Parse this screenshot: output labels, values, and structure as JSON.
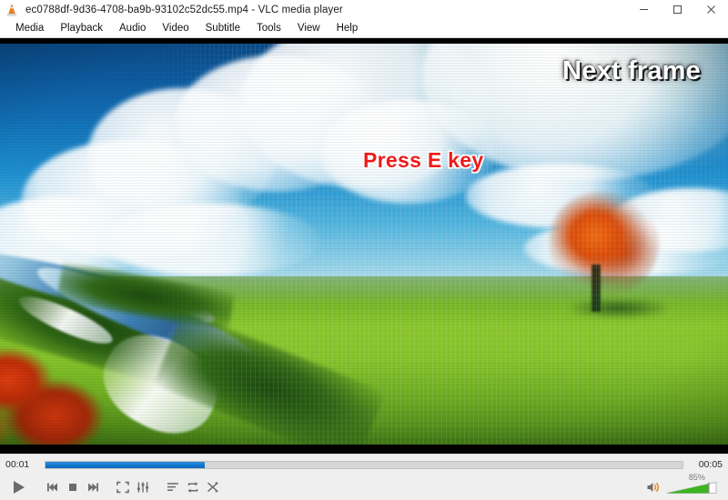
{
  "window": {
    "app_icon": "vlc-cone-icon",
    "title": "ec0788df-9d36-4708-ba9b-93102c52dc55.mp4 - VLC media player",
    "controls": {
      "minimize": "minimize-icon",
      "maximize": "maximize-icon",
      "close": "close-icon"
    }
  },
  "menubar": {
    "items": [
      {
        "label": "Media"
      },
      {
        "label": "Playback"
      },
      {
        "label": "Audio"
      },
      {
        "label": "Video"
      },
      {
        "label": "Subtitle"
      },
      {
        "label": "Tools"
      },
      {
        "label": "View"
      },
      {
        "label": "Help"
      }
    ]
  },
  "video": {
    "description": "Green rolling field with blue sky, white clouds, a stream and an autumn tree",
    "overlays": [
      {
        "id": "next-frame",
        "text": "Next frame",
        "color": "#ffffff"
      },
      {
        "id": "press-e-key",
        "text": "Press E key",
        "color": "#ef1b1b"
      }
    ]
  },
  "seekbar": {
    "elapsed": "00:01",
    "total": "00:05",
    "progress_percent": 25,
    "fill_color": "#1277cd",
    "track_color": "#d6d6d6"
  },
  "controls": {
    "buttons": [
      {
        "name": "play-button",
        "icon": "play-icon"
      },
      {
        "name": "previous-button",
        "icon": "previous-icon"
      },
      {
        "name": "stop-button",
        "icon": "stop-icon"
      },
      {
        "name": "next-button",
        "icon": "next-icon"
      },
      {
        "name": "fullscreen-button",
        "icon": "fullscreen-icon"
      },
      {
        "name": "settings-button",
        "icon": "equalizer-icon"
      },
      {
        "name": "playlist-button",
        "icon": "playlist-icon"
      },
      {
        "name": "loop-button",
        "icon": "loop-icon"
      },
      {
        "name": "shuffle-button",
        "icon": "shuffle-icon"
      }
    ],
    "volume": {
      "icon": "volume-icon",
      "level_label": "85%",
      "level_percent": 85,
      "fill_color": "#3cb521"
    }
  }
}
